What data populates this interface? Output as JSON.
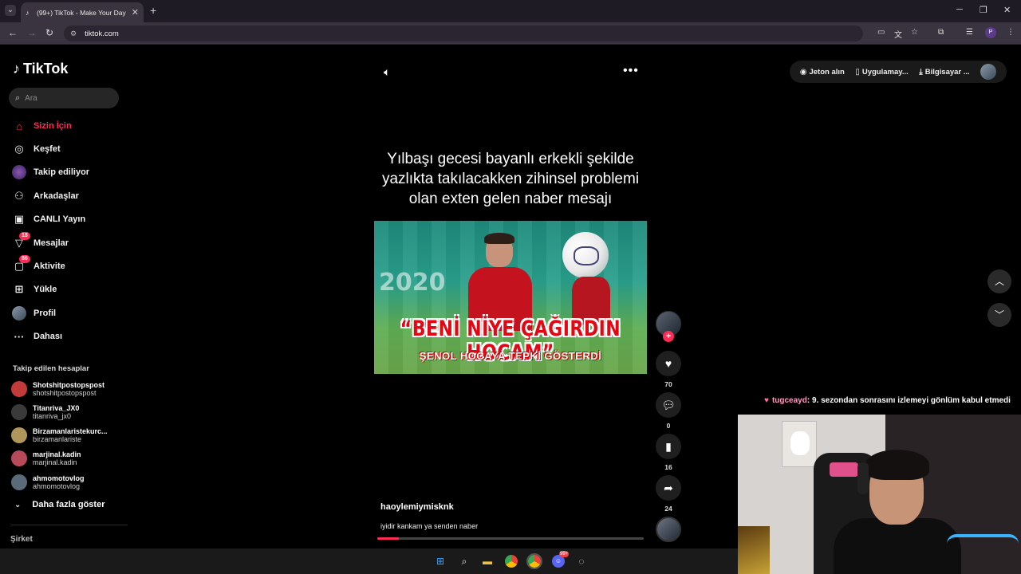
{
  "browser": {
    "tab_title": "(99+) TikTok - Make Your Day",
    "url": "tiktok.com"
  },
  "tiktok": {
    "brand": "TikTok",
    "search_placeholder": "Ara",
    "nav": [
      {
        "label": "Sizin İçin",
        "icon": "home-icon",
        "active": true
      },
      {
        "label": "Keşfet",
        "icon": "compass-icon"
      },
      {
        "label": "Takip ediliyor",
        "icon": "following-icon"
      },
      {
        "label": "Arkadaşlar",
        "icon": "friends-icon"
      },
      {
        "label": "CANLI Yayın",
        "icon": "live-icon"
      },
      {
        "label": "Mesajlar",
        "icon": "messages-icon",
        "badge": "18"
      },
      {
        "label": "Aktivite",
        "icon": "activity-icon",
        "badge": "86"
      },
      {
        "label": "Yükle",
        "icon": "upload-icon"
      },
      {
        "label": "Profil",
        "icon": "profile-icon"
      },
      {
        "label": "Dahası",
        "icon": "more-icon"
      }
    ],
    "following_title": "Takip edilen hesaplar",
    "following": [
      {
        "name": "Shotshitpostopspost",
        "handle": "shotshitpostopspost",
        "color": "#c23b3b"
      },
      {
        "name": "Titanriva_JX0",
        "handle": "titanriva_jx0",
        "color": "#3a3a3a"
      },
      {
        "name": "Birzamanlaristekurc...",
        "handle": "birzamanlariste",
        "color": "#b0965a"
      },
      {
        "name": "marjinal.kadin",
        "handle": "marjinal.kadin",
        "color": "#b74a5a"
      },
      {
        "name": "ahmomotovlog",
        "handle": "ahmomotovlog",
        "color": "#5a6a78"
      }
    ],
    "show_more": "Daha fazla göster",
    "company": "Şirket",
    "header": {
      "coins": "Jeton alın",
      "app": "Uygulamay...",
      "desktop": "Bilgisayar ..."
    },
    "video": {
      "caption": "Yılbaşı gecesi bayanlı erkekli şekilde yazlıkta takılacakken zihinsel problemi olan exten gelen naber mesajı",
      "frame_year": "2020",
      "headline": "“BENİ NİYE ÇAĞIRDIN HOCAM”",
      "subheadline": "ŞENOL HOCAYA TEPKİ GÖSTERDİ",
      "author": "haoylemiymisknk",
      "description": "iyidir kankam ya senden naber",
      "likes": "70",
      "comments": "0",
      "saves": "16",
      "shares": "24",
      "progress_percent": 8
    }
  },
  "stream": {
    "chat_user": "tugceayd",
    "chat_message": ": 9. sezondan sonrasını izlemeyi gönlüm kabul etmedi"
  },
  "taskbar": {
    "discord_badge": "99+"
  }
}
